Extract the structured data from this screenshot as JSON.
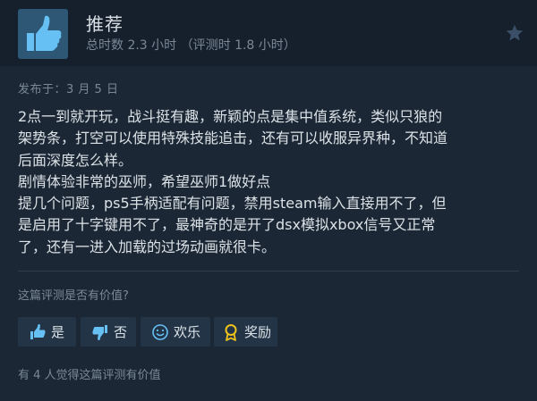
{
  "header": {
    "title": "推荐",
    "hours_text": "总时数 2.3 小时 （评测时 1.8 小时）"
  },
  "posted": "发布于：3 月 5 日",
  "review_lines": [
    "2点一到就开玩，战斗挺有趣，新颖的点是集中值系统，类似只狼的",
    "架势条，打空可以使用特殊技能追击，还有可以收服异界种，不知道",
    "后面深度怎么样。",
    "剧情体验非常的巫师，希望巫师1做好点",
    "提几个问题，ps5手柄适配有问题，禁用steam输入直接用不了，但",
    "是启用了十字键用不了，最神奇的是开了dsx模拟xbox信号又正常",
    "了，还有一进入加载的过场动画就很卡。"
  ],
  "vote": {
    "question": "这篇评测是否有价值?",
    "yes": "是",
    "no": "否",
    "funny": "欢乐",
    "award": "奖励"
  },
  "helpful_text": "有 4 人觉得这篇评测有价值",
  "icons": {
    "recommend": "thumbs-up-icon",
    "star": "star-icon",
    "yes": "thumbs-up-icon",
    "no": "thumbs-down-icon",
    "funny": "smiley-icon",
    "award": "award-icon"
  },
  "colors": {
    "background": "#1c2736",
    "header_bg": "#16202d",
    "thumb_box": "#2e5675",
    "button_bg": "#233447",
    "award_accent": "#f0c419"
  }
}
